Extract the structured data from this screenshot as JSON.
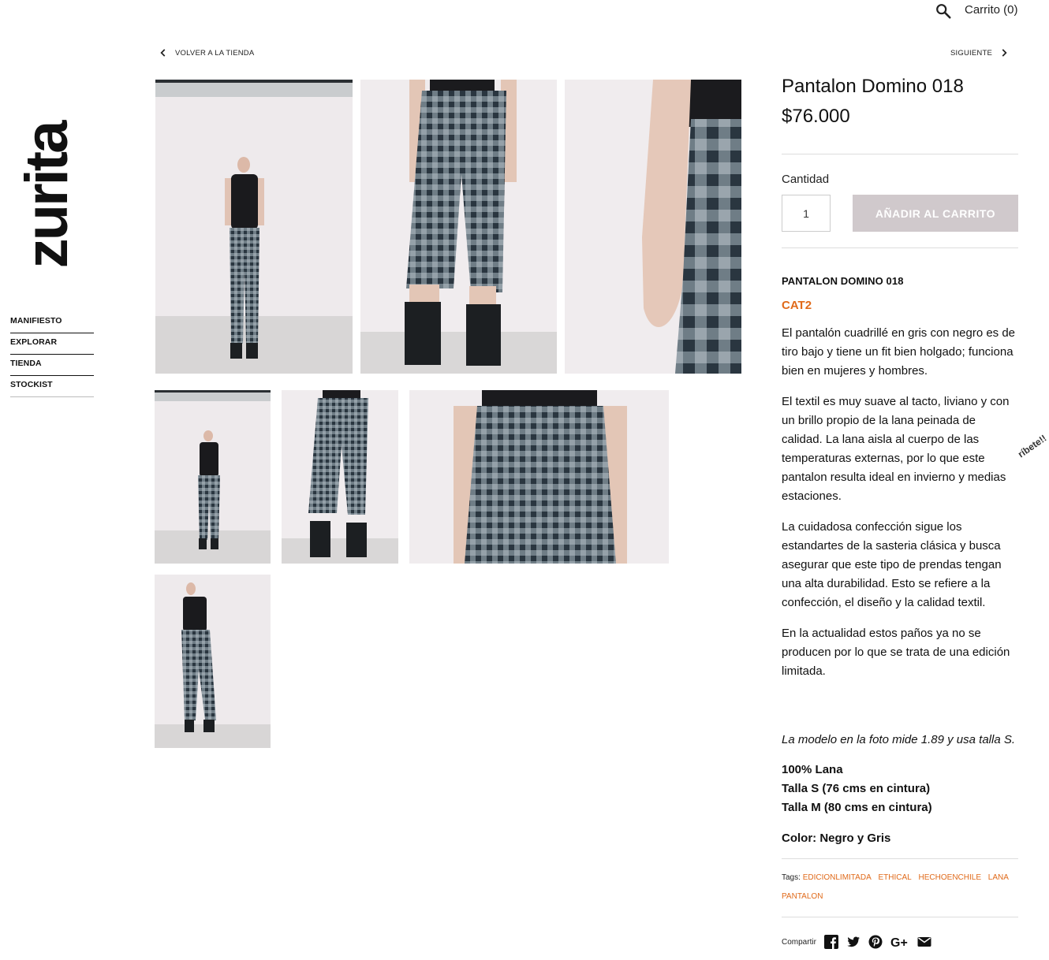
{
  "header": {
    "cart_label": "Carrito (0)"
  },
  "brand": {
    "logo_text": "zurita"
  },
  "nav": {
    "items": [
      {
        "label": "MANIFIESTO"
      },
      {
        "label": "EXPLORAR"
      },
      {
        "label": "TIENDA"
      },
      {
        "label": "STOCKIST"
      }
    ]
  },
  "pager": {
    "back_label": "VOLVER A LA TIENDA",
    "next_label": "SIGUIENTE"
  },
  "product": {
    "title": "Pantalon Domino 018",
    "price": "$76.000",
    "quantity_label": "Cantidad",
    "quantity_value": "1",
    "add_button": "AÑADIR AL CARRITO",
    "heading": "PANTALON DOMINO 018",
    "category": "CAT2",
    "paragraphs": [
      "El pantalón cuadrillé en gris con negro es de tiro bajo y tiene un fit bien holgado; funciona bien en mujeres y hombres.",
      "El textil es muy suave al tacto, liviano y con un brillo propio de la lana peinada de calidad. La lana aisla al cuerpo de las temperaturas externas, por lo que este pantalon resulta ideal en invierno y medias estaciones.",
      "La cuidadosa confección sigue los estandartes de la sasteria clásica y busca asegurar que este tipo de prendas tengan una alta durabilidad. Esto se refiere a la confección, el diseño y la calidad textil.",
      "En la actualidad estos paños ya no se producen por lo que se trata de una edición limitada."
    ],
    "model_note": "La modelo en la foto mide 1.89 y usa talla S.",
    "material": "100% Lana",
    "size_s": "Talla S (76 cms en cintura)",
    "size_m": "Talla M (80 cms en cintura)",
    "color": "Color: Negro y Gris",
    "tags_label": "Tags:",
    "tags": [
      "EDICIONLIMITADA",
      "ETHICAL",
      "HECHOENCHILE",
      "LANA",
      "PANTALON"
    ],
    "share_label": "Compartir",
    "share_icons": [
      "facebook-icon",
      "twitter-icon",
      "pinterest-icon",
      "google-plus-icon",
      "email-icon"
    ]
  },
  "popup": {
    "subscribe_label": "ríbete!!"
  },
  "colors": {
    "accent": "#e06a1a",
    "button": "#d0c9cc"
  }
}
